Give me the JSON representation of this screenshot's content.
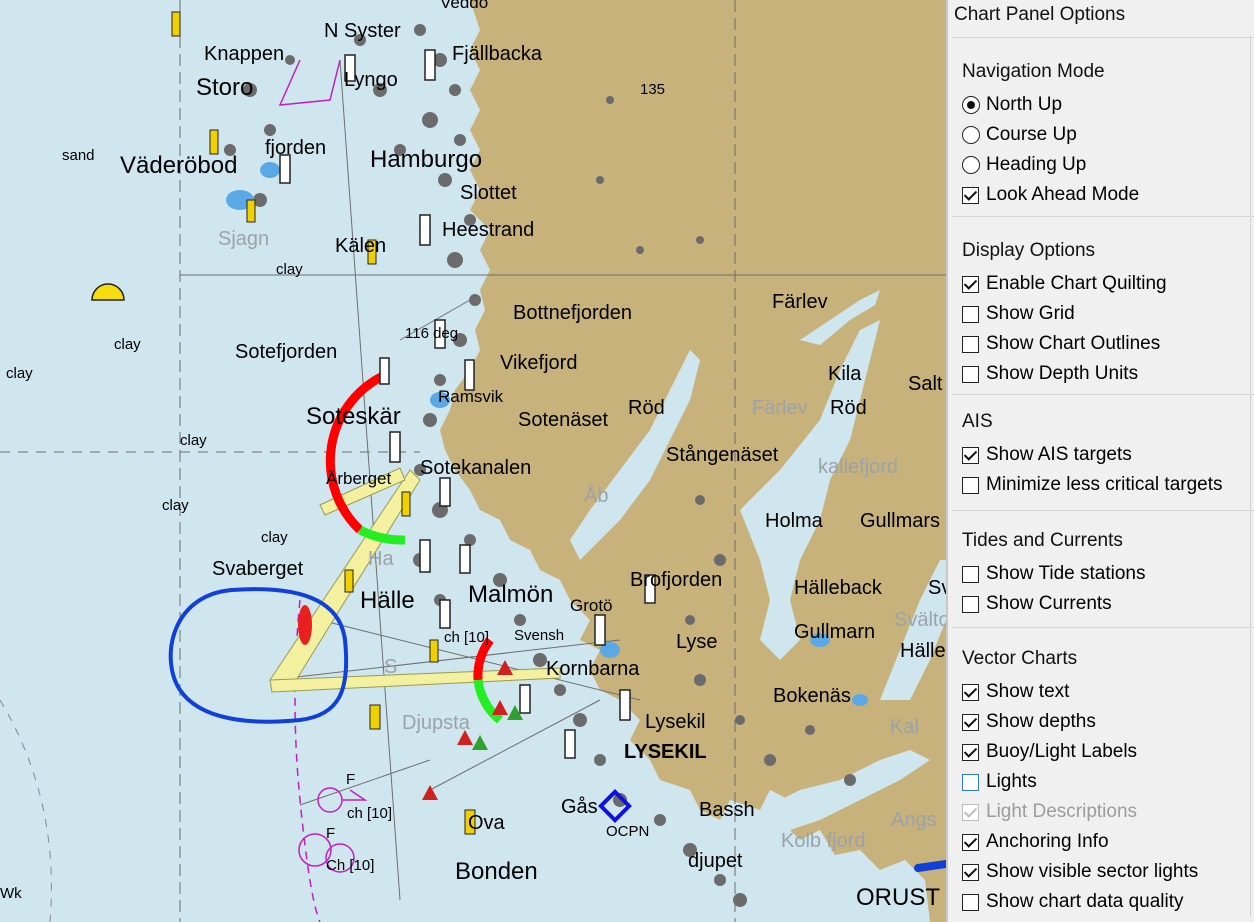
{
  "map": {
    "labels": {
      "vaddo": "Veddo",
      "n_syster": "N Syster",
      "knappen": "Knappen",
      "lyngo": "Lyngo",
      "fjallbacka": "Fjällbacka",
      "storo": "Storo",
      "depth135": "135",
      "sand": "sand",
      "vaderobod": "Väderöbod",
      "fjorden": "fjorden",
      "hamburgo": "Hamburgo",
      "slottet": "Slottet",
      "heestrand": "Heestrand",
      "sjagn": "Sjagn",
      "kalen": "Kälen",
      "clay1": "clay",
      "bottnefjorden": "Bottnefjorden",
      "farlev": "Färlev",
      "deg116": "116 deg",
      "clay2": "clay",
      "sotefjorden": "Sotefjorden",
      "vikefjord": "Vikefjord",
      "kila": "Kila",
      "salt": "Salt",
      "clay3": "clay",
      "ramsvik": "Ramsvik",
      "farlev2": "Färlev",
      "rod": "Röd",
      "rod2": "Röd",
      "soteskar": "Soteskär",
      "sotenaset": "Sotenäset",
      "clay4": "clay",
      "stangenaset": "Stångenäset",
      "kallefjord": "kallefjord",
      "sotekanalen": "Sotekanalen",
      "berberget": "Ärberget",
      "clay5": "clay",
      "ab": "Åb",
      "holma": "Holma",
      "gullmars": "Gullmars",
      "clay6": "clay",
      "svaberget": "Svaberget",
      "ha": "Ha",
      "brofjorden": "Brofjorden",
      "hallebeck": "Hälleback",
      "sv": "Sv",
      "halle": "Hälle",
      "malmon": "Malmön",
      "groto": "Grotö",
      "svalto": "Svälto",
      "ch10a": "ch [10]",
      "svensh": "Svensh",
      "lyse": "Lyse",
      "gullmarn": "Gullmarn",
      "halle2": "Hälle",
      "s": "S",
      "kornbarna": "Kornbarna",
      "bokenas": "Bokenäs",
      "djupsta": "Djupsta",
      "lysekil": "Lysekil",
      "kal": "Kal",
      "lysekil_caps": "LYSEKIL",
      "f1": "F",
      "ch10b": "ch [10]",
      "gas": "Gås",
      "bassh": "Bassh",
      "angs": "Angs",
      "ova": "Ova",
      "ocpn": "OCPN",
      "f2": "F",
      "kolb_fjord": "Kolb fjord",
      "ch10c": "Ch [10]",
      "djupet": "djupet",
      "bonden": "Bonden",
      "orust": "ORUST",
      "wk": "Wk"
    },
    "colors": {
      "water": "#cfe6ef",
      "land": "#c8b27c",
      "sector_red": "#ff0000",
      "sector_green": "#22ee22",
      "sector_light": "#f3f0a0",
      "highlight": "#1040d8",
      "purple": "#c020c0"
    }
  },
  "panel": {
    "title": "Chart Panel Options",
    "sections": [
      {
        "title": "Navigation Mode",
        "items": [
          {
            "type": "radio",
            "label": "North Up",
            "checked": true
          },
          {
            "type": "radio",
            "label": "Course Up",
            "checked": false
          },
          {
            "type": "radio",
            "label": "Heading Up",
            "checked": false
          },
          {
            "type": "checkbox",
            "label": "Look Ahead Mode",
            "checked": true
          }
        ]
      },
      {
        "title": "Display Options",
        "items": [
          {
            "type": "checkbox",
            "label": "Enable Chart Quilting",
            "checked": true
          },
          {
            "type": "checkbox",
            "label": "Show Grid",
            "checked": false
          },
          {
            "type": "checkbox",
            "label": "Show Chart Outlines",
            "checked": false
          },
          {
            "type": "checkbox",
            "label": "Show Depth Units",
            "checked": false
          }
        ]
      },
      {
        "title": "AIS",
        "items": [
          {
            "type": "checkbox",
            "label": "Show AIS targets",
            "checked": true
          },
          {
            "type": "checkbox",
            "label": "Minimize less critical targets",
            "checked": false
          }
        ]
      },
      {
        "title": "Tides and Currents",
        "items": [
          {
            "type": "checkbox",
            "label": "Show Tide stations",
            "checked": false
          },
          {
            "type": "checkbox",
            "label": "Show Currents",
            "checked": false
          }
        ]
      },
      {
        "title": "Vector Charts",
        "items": [
          {
            "type": "checkbox",
            "label": "Show text",
            "checked": true
          },
          {
            "type": "checkbox",
            "label": "Show depths",
            "checked": true
          },
          {
            "type": "checkbox",
            "label": "Buoy/Light Labels",
            "checked": true
          },
          {
            "type": "checkbox",
            "label": "Lights",
            "checked": false,
            "focused": true
          },
          {
            "type": "checkbox",
            "label": "Light Descriptions",
            "checked": true,
            "disabled": true
          },
          {
            "type": "checkbox",
            "label": "Anchoring Info",
            "checked": true
          },
          {
            "type": "checkbox",
            "label": "Show visible sector lights",
            "checked": true
          },
          {
            "type": "checkbox",
            "label": "Show chart data quality",
            "checked": false
          }
        ]
      }
    ]
  }
}
